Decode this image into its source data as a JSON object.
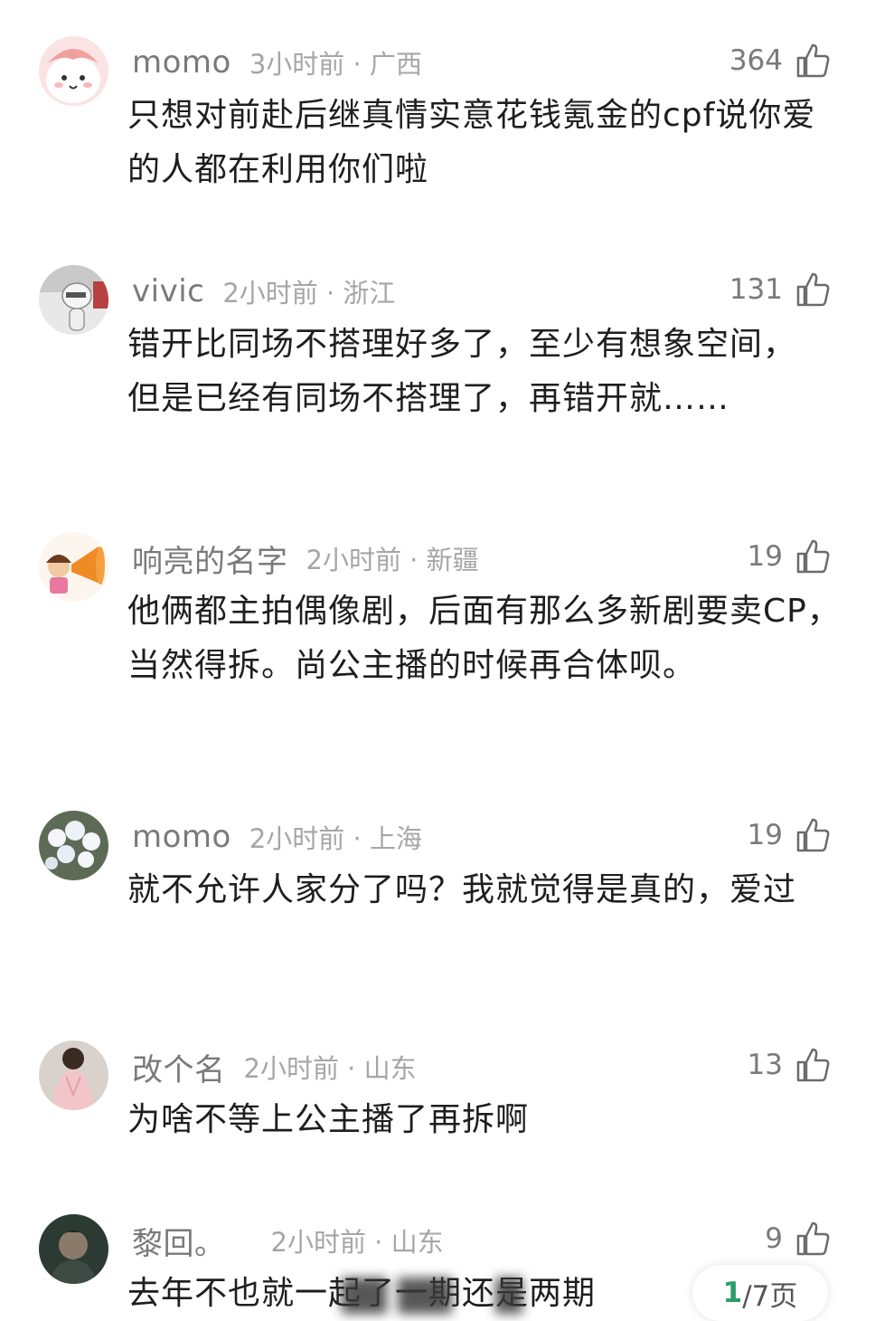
{
  "comments": [
    {
      "username": "momo",
      "time_location": "3小时前 · 广西",
      "likes": "364",
      "text": "只想对前赴后继真情实意花钱氪金的cpf说你爱的人都在利用你们啦"
    },
    {
      "username": "vivic",
      "time_location": "2小时前 · 浙江",
      "likes": "131",
      "text": "错开比同场不搭理好多了，至少有想象空间，但是已经有同场不搭理了，再错开就……"
    },
    {
      "username": "响亮的名字",
      "time_location": "2小时前 · 新疆",
      "likes": "19",
      "text": "他俩都主拍偶像剧，后面有那么多新剧要卖CP，当然得拆。尚公主播的时候再合体呗。"
    },
    {
      "username": "momo",
      "time_location": "2小时前 · 上海",
      "likes": "19",
      "text": "就不允许人家分了吗？我就觉得是真的，爱过"
    },
    {
      "username": "改个名",
      "time_location": "2小时前 · 山东",
      "likes": "13",
      "text": "为啥不等上公主播了再拆啊"
    },
    {
      "username": "黎回。",
      "time_location": "2小时前 · 山东",
      "likes": "9",
      "text": "去年不也就一起了一期还是两期"
    }
  ],
  "pager": {
    "current": "1",
    "rest": "/7页"
  },
  "colors": {
    "username": "#7a7a7a",
    "meta": "#a6a6a6",
    "body": "#1e1e1e",
    "pager_current": "#2a9d68"
  },
  "icons": [
    "avatar",
    "thumbs-up-icon"
  ]
}
